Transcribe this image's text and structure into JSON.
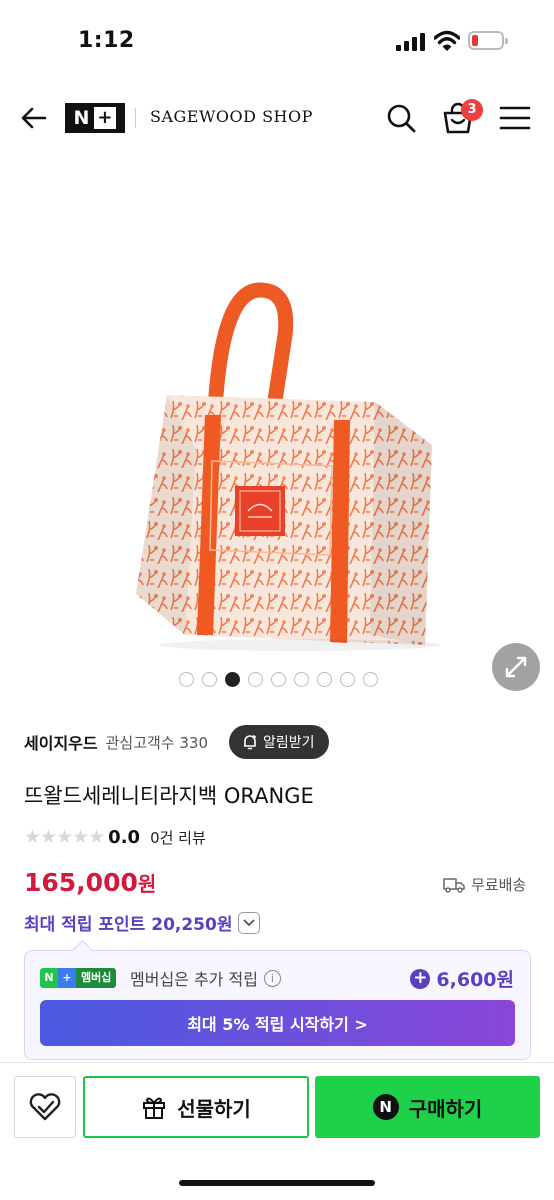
{
  "status_bar": {
    "time": "1:12"
  },
  "header": {
    "brand_badge": "N",
    "brand_badge_plus": "+",
    "shop_name": "SAGEWOOD SHOP",
    "cart_count": "3"
  },
  "gallery": {
    "image_count": 9,
    "active_index": 2
  },
  "seller": {
    "name": "세이지우드",
    "interest_label": "관심고객수 330",
    "alarm_label": "알림받기"
  },
  "product": {
    "title": "뜨왈드세레니티라지백 ORANGE",
    "stars": "★★★★★",
    "rating": "0.0",
    "review_count": "0건 리뷰",
    "price": "165,000",
    "price_unit": "원",
    "shipping": "무료배송",
    "max_points": "최대 적립 포인트 20,250원"
  },
  "membership": {
    "badge_n": "N",
    "badge_plus": "+",
    "badge_text": "멤버십",
    "description": "멤버십은 추가 적립",
    "info": "i",
    "plus": "+",
    "amount": "6,600원",
    "cta": "최대 5% 적립 시작하기 >"
  },
  "bottom": {
    "gift_label": "선물하기",
    "buy_icon": "N",
    "buy_label": "구매하기"
  },
  "colors": {
    "price_red": "#d11a3c",
    "points_purple": "#5b3fbf",
    "naver_green": "#1fd14a",
    "bag_orange": "#f15a24"
  }
}
